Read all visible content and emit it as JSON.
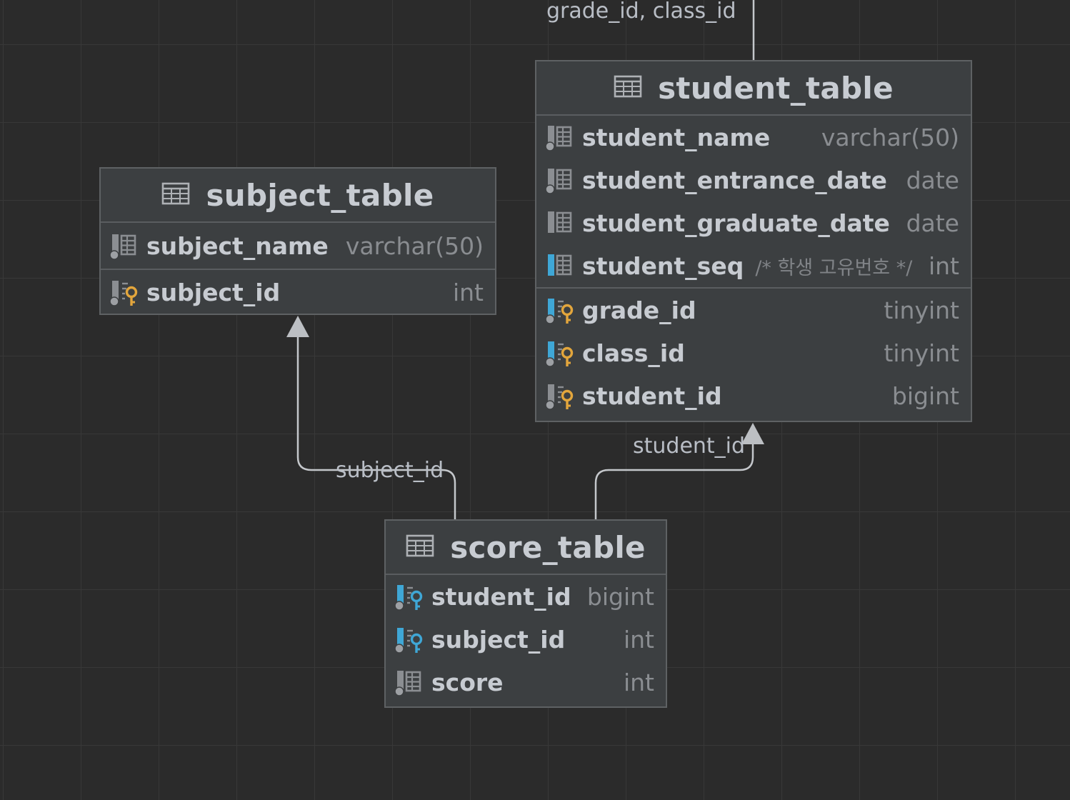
{
  "tables": {
    "student": {
      "name": "student_table",
      "columns": [
        {
          "name": "student_name",
          "type": "varchar(50)",
          "icon": "column-nullable-icon"
        },
        {
          "name": "student_entrance_date",
          "type": "date",
          "icon": "column-nullable-icon"
        },
        {
          "name": "student_graduate_date",
          "type": "date",
          "icon": "column-icon"
        },
        {
          "name": "student_seq",
          "comment": "/* 학생 고유번호 */",
          "type": "int",
          "icon": "column-icon"
        }
      ],
      "keys": [
        {
          "name": "grade_id",
          "type": "tinyint",
          "icon": "primary-foreign-key-icon"
        },
        {
          "name": "class_id",
          "type": "tinyint",
          "icon": "primary-foreign-key-icon"
        },
        {
          "name": "student_id",
          "type": "bigint",
          "icon": "primary-key-icon"
        }
      ]
    },
    "subject": {
      "name": "subject_table",
      "columns": [
        {
          "name": "subject_name",
          "type": "varchar(50)",
          "icon": "column-nullable-icon"
        }
      ],
      "keys": [
        {
          "name": "subject_id",
          "type": "int",
          "icon": "primary-key-icon"
        }
      ]
    },
    "score": {
      "name": "score_table",
      "columns": [
        {
          "name": "student_id",
          "type": "bigint",
          "icon": "foreign-key-icon"
        },
        {
          "name": "subject_id",
          "type": "int",
          "icon": "foreign-key-icon"
        },
        {
          "name": "score",
          "type": "int",
          "icon": "column-nullable-icon"
        }
      ]
    }
  },
  "relations": {
    "top_label": "grade_id, class_id",
    "subject_label": "subject_id",
    "student_label": "student_id"
  },
  "colors": {
    "background": "#2b2b2b",
    "grid": "#383838",
    "table_bg": "#3c3f41",
    "primary_key": "#e3a63c",
    "foreign_key": "#3fa7d6",
    "column_icon": "#8b8e92",
    "connector": "#c4c7cb"
  }
}
